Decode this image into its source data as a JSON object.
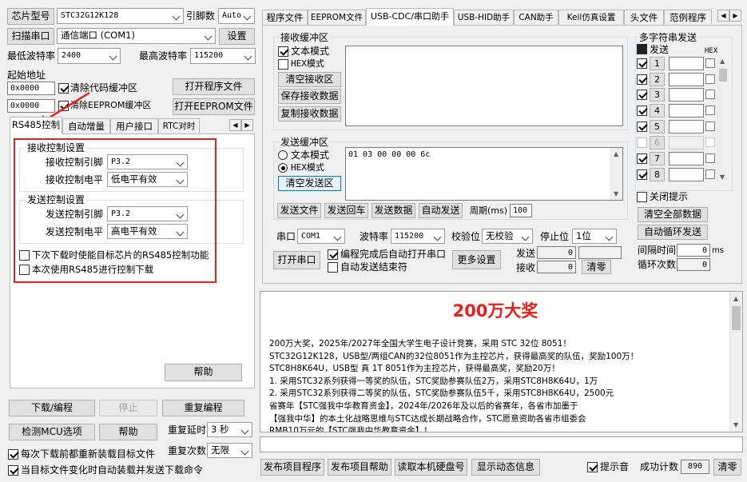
{
  "left": {
    "chip_label": "芯片型号",
    "chip_value": "STC32G12K128",
    "pins_label": "引脚数",
    "pins_value": "Auto",
    "scan_button": "扫描串口",
    "port_value": "通信端口 (COM1)",
    "settings_button": "设置",
    "min_baud_label": "最低波特率",
    "min_baud_value": "2400",
    "max_baud_label": "最高波特率",
    "max_baud_value": "115200",
    "start_addr_label": "起始地址",
    "code_addr": "0x0000",
    "clear_code_label": "清除代码缓冲区",
    "open_program_button": "打开程序文件",
    "eeprom_addr": "0x0000",
    "clear_eeprom_label": "清除EEPROM缓冲区",
    "open_eeprom_button": "打开EEPROM文件",
    "tabs": [
      "RS485控制",
      "自动增量",
      "用户接口",
      "RTC对时"
    ],
    "recv_group": "接收控制设置",
    "recv_pin_label": "接收控制引脚",
    "recv_pin_value": "P3.2",
    "recv_level_label": "接收控制电平",
    "recv_level_value": "低电平有效",
    "send_group": "发送控制设置",
    "send_pin_label": "发送控制引脚",
    "send_pin_value": "P3.2",
    "send_level_label": "发送控制电平",
    "send_level_value": "高电平有效",
    "next_download_label": "下次下载时使能目标芯片的RS485控制功能",
    "this_download_label": "本次使用RS485进行控制下载",
    "help_button": "帮助",
    "download_button": "下载/编程",
    "stop_button": "停止",
    "reprogram_button": "重复编程",
    "check_mcu_button": "检测MCU选项",
    "help2_button": "帮助",
    "repeat_delay_label": "重复延时",
    "repeat_delay_value": "3 秒",
    "repeat_count_label": "重复次数",
    "repeat_count_value": "无限",
    "reload_label": "每次下载前都重新装载目标文件",
    "auto_reload_label": "当目标文件变化时自动装载并发送下载命令"
  },
  "right": {
    "tabs": [
      "程序文件",
      "EEPROM文件",
      "USB-CDC/串口助手",
      "USB-HID助手",
      "CAN助手",
      "Keil仿真设置",
      "头文件",
      "范例程序"
    ],
    "recv_buffer_title": "接收缓冲区",
    "recv_text_mode": "文本模式",
    "recv_hex_mode": "HEX模式",
    "clear_recv_button": "清空接收区",
    "save_recv_button": "保存接收数据",
    "copy_recv_button": "复制接收数据",
    "send_buffer_title": "发送缓冲区",
    "send_text_mode": "文本模式",
    "send_hex_mode": "HEX模式",
    "clear_send_button": "清空发送区",
    "send_content": "01 03 00 00 00 6c",
    "send_file_button": "发送文件",
    "send_return_button": "发送回车",
    "send_data_button": "发送数据",
    "auto_send_button": "自动发送",
    "period_label": "周期(ms)",
    "period_value": "100",
    "port_label": "串口",
    "port_value": "COM1",
    "baud_label": "波特率",
    "baud_value": "115200",
    "parity_label": "校验位",
    "parity_value": "无校验",
    "stopbit_label": "停止位",
    "stopbit_value": "1位",
    "open_port_button": "打开串口",
    "auto_open_label": "编程完成后自动打开串口",
    "auto_end_label": "自动发送结束符",
    "more_settings_button": "更多设置",
    "sent_label": "发送",
    "sent_value": "0",
    "recv_label": "接收",
    "recv_value": "0",
    "clear_count_button": "清零",
    "multi_title": "多字符串发送",
    "multi_send_label": "发送",
    "multi_hex_label": "HEX",
    "multi_rows": [
      "1",
      "2",
      "3",
      "4",
      "5",
      "6",
      "7",
      "8"
    ],
    "close_hint_label": "关闭提示",
    "clear_all_button": "清空全部数据",
    "auto_loop_button": "自动循环发送",
    "interval_label": "间隔时间",
    "interval_value": "0",
    "interval_unit": "ms",
    "loop_count_label": "循环次数",
    "loop_count_value": "0"
  },
  "news": {
    "title": "200万大奖",
    "lines": [
      "200万大奖，2025年/2027年全国大学生电子设计竞赛，采用 STC 32位 8051！",
      "STC32G12K128，USB型/两组CAN的32位8051作为主控芯片，获得最高奖的队伍，奖励100万！",
      "STC8H8K64U，USB型 真 1T 8051作为主控芯片，获得最高奖，奖励20万！",
      "1. 采用STC32系列获得一等奖的队伍，STC奖励参赛队伍2万，采用STC8H8K64U，1万",
      "2. 采用STC32系列获得二等奖的队伍，STC奖励参赛队伍5千，采用STC8H8K64U，2500元",
      "省赛年【STC强我中华教育资金】，2024年/2026年及以后的省赛年，各省市加墨于",
      "【强我中华】的本土化战略思维与STC达成长期战略合作，STC愿意资助各省市组委会",
      "RMB10万元的【STC强我中华教育资金】！"
    ]
  },
  "bottom": {
    "publish_program_button": "发布项目程序",
    "publish_help_button": "发布项目帮助",
    "read_serial_button": "读取本机硬盘号",
    "show_dynamic_button": "显示动态信息",
    "beep_label": "提示音",
    "success_count_label": "成功计数",
    "success_count_value": "890",
    "clear_button": "清零"
  },
  "colors": {
    "highlight_box": "#e8201a",
    "news_title": "#e8201a",
    "arrow": "#e8201a"
  }
}
